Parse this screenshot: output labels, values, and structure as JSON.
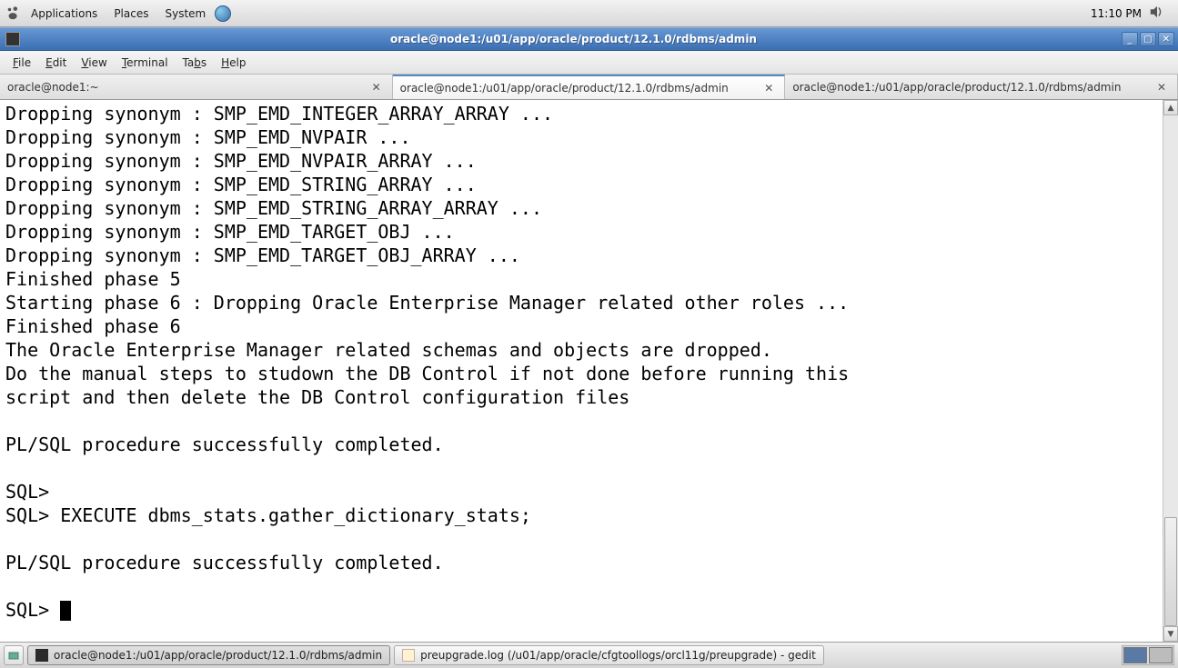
{
  "top_panel": {
    "menus": [
      "Applications",
      "Places",
      "System"
    ],
    "clock": "11:10 PM"
  },
  "window": {
    "title": "oracle@node1:/u01/app/oracle/product/12.1.0/rdbms/admin"
  },
  "menubar": {
    "file": "File",
    "edit": "Edit",
    "view": "View",
    "terminal": "Terminal",
    "tabs": "Tabs",
    "help": "Help"
  },
  "tabs": [
    {
      "label": "oracle@node1:~",
      "active": false
    },
    {
      "label": "oracle@node1:/u01/app/oracle/product/12.1.0/rdbms/admin",
      "active": true
    },
    {
      "label": "oracle@node1:/u01/app/oracle/product/12.1.0/rdbms/admin",
      "active": false
    }
  ],
  "terminal_lines": [
    "Dropping synonym : SMP_EMD_INTEGER_ARRAY_ARRAY ...",
    "Dropping synonym : SMP_EMD_NVPAIR ...",
    "Dropping synonym : SMP_EMD_NVPAIR_ARRAY ...",
    "Dropping synonym : SMP_EMD_STRING_ARRAY ...",
    "Dropping synonym : SMP_EMD_STRING_ARRAY_ARRAY ...",
    "Dropping synonym : SMP_EMD_TARGET_OBJ ...",
    "Dropping synonym : SMP_EMD_TARGET_OBJ_ARRAY ...",
    "Finished phase 5",
    "Starting phase 6 : Dropping Oracle Enterprise Manager related other roles ...",
    "Finished phase 6",
    "The Oracle Enterprise Manager related schemas and objects are dropped.",
    "Do the manual steps to studown the DB Control if not done before running this",
    "script and then delete the DB Control configuration files",
    "",
    "PL/SQL procedure successfully completed.",
    "",
    "SQL>",
    "SQL> EXECUTE dbms_stats.gather_dictionary_stats;",
    "",
    "PL/SQL procedure successfully completed.",
    "",
    "SQL> "
  ],
  "taskbar": {
    "items": [
      {
        "label": "oracle@node1:/u01/app/oracle/product/12.1.0/rdbms/admin",
        "icon": "term",
        "active": true
      },
      {
        "label": "preupgrade.log (/u01/app/oracle/cfgtoollogs/orcl11g/preupgrade) - gedit",
        "icon": "edit",
        "active": false
      }
    ]
  }
}
